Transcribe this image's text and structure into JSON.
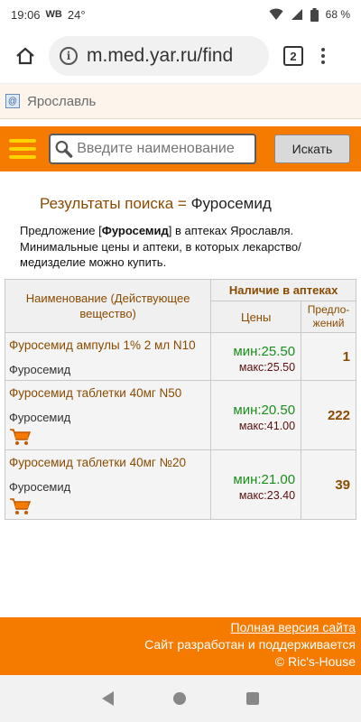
{
  "status_bar": {
    "time": "19:06",
    "carrier": "WB",
    "temperature": "24°",
    "battery": "68 %"
  },
  "browser": {
    "url": "m.med.yar.ru/find",
    "tab_count": "2",
    "icons": [
      "home-icon",
      "info-icon",
      "tabs-icon",
      "more-vert-icon"
    ]
  },
  "city": {
    "name": "Ярославль"
  },
  "search": {
    "placeholder": "Введите наименование",
    "button_label": "Искать"
  },
  "results": {
    "title_prefix": "Результаты поиска = ",
    "query": "Фуросемид",
    "desc_before": "Предложение [",
    "desc_query": "Фуросемид",
    "desc_after": "] в аптеках Ярославля. Минимальные цены и аптеки, в которых лекарство/медизделие можно купить."
  },
  "table": {
    "header_name": "Наименование (Действующее вещество)",
    "header_availability": "Наличие в аптеках",
    "header_prices": "Цены",
    "header_offers": "Предло-жений",
    "rows": [
      {
        "name": "Фуросемид ампулы 1% 2 мл N10",
        "substance": "Фуросемид",
        "min_price": "мин:25.50",
        "max_price": "макс:25.50",
        "offers": "1",
        "cart": false
      },
      {
        "name": "Фуросемид таблетки 40мг N50",
        "substance": "Фуросемид",
        "min_price": "мин:20.50",
        "max_price": "макс:41.00",
        "offers": "222",
        "cart": true
      },
      {
        "name": "Фуросемид таблетки 40мг №20",
        "substance": "Фуросемид",
        "min_price": "мин:21.00",
        "max_price": "макс:23.40",
        "offers": "39",
        "cart": true
      }
    ]
  },
  "footer": {
    "full_version_link": "Полная версия сайта",
    "developed_text": "Сайт разработан и поддерживается",
    "copyright": "© Ric's-House"
  },
  "colors": {
    "accent_orange": "#f57a00",
    "hamburger_yellow": "#ffd200",
    "link_brown": "#8a4b00",
    "min_price_green": "#1a8f1a"
  }
}
